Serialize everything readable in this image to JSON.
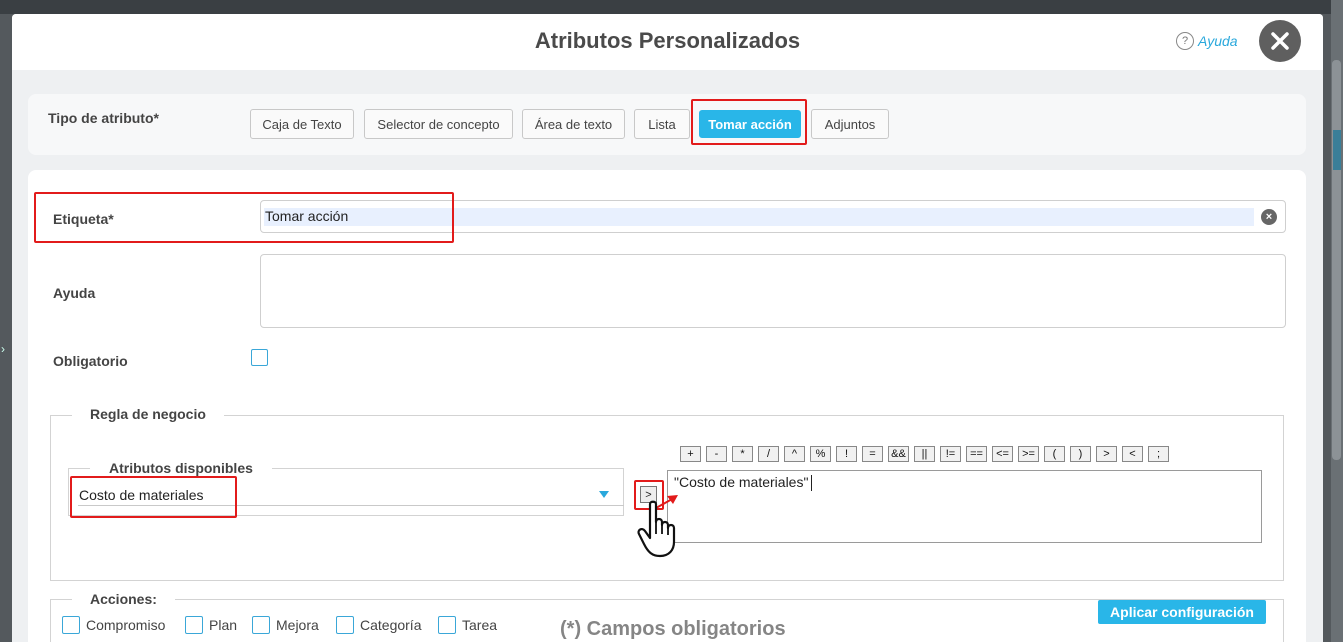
{
  "window": {
    "title": "Atributos Personalizados",
    "help_label": "Ayuda",
    "help_symbol": "?",
    "close_symbol": "✕"
  },
  "background": {
    "underlying_text": "(*) Campos obligatorios",
    "left_chevron": "›"
  },
  "attribute_type": {
    "label": "Tipo de atributo*",
    "options": [
      "Caja de Texto",
      "Selector de concepto",
      "Área de texto",
      "Lista",
      "Tomar acción",
      "Adjuntos"
    ],
    "selected": "Tomar acción"
  },
  "form": {
    "etiqueta_label": "Etiqueta*",
    "etiqueta_value": "Tomar acción",
    "clear_symbol": "×",
    "ayuda_label": "Ayuda",
    "ayuda_value": "",
    "obligatorio_label": "Obligatorio",
    "obligatorio_checked": false
  },
  "business_rule": {
    "legend": "Regla de negocio",
    "available_legend": "Atributos disponibles",
    "selected_attribute": "Costo de materiales",
    "add_symbol": ">",
    "operators": [
      "+",
      "-",
      "*",
      "/",
      "^",
      "%",
      "!",
      "=",
      "&&",
      "||",
      "!=",
      "==",
      "<=",
      ">=",
      "(",
      ")",
      ">",
      "<",
      ";"
    ],
    "expression": "\"Costo de materiales\""
  },
  "actions": {
    "legend": "Acciones:",
    "items": [
      {
        "label": "Compromiso",
        "checked": false
      },
      {
        "label": "Plan",
        "checked": false
      },
      {
        "label": "Mejora",
        "checked": false
      },
      {
        "label": "Categoría",
        "checked": false
      },
      {
        "label": "Tarea",
        "checked": false
      }
    ],
    "apply_label": "Aplicar configuración"
  },
  "colors": {
    "accent": "#29b6e8",
    "highlight": "#e21b1b",
    "checkbox_border": "#3aa7d8"
  },
  "icons": {
    "close": "close-icon",
    "help": "help-icon",
    "clear": "clear-icon",
    "dropdown": "chevron-down-icon",
    "pointer": "hand-pointer-icon",
    "arrow": "arrow-icon"
  }
}
